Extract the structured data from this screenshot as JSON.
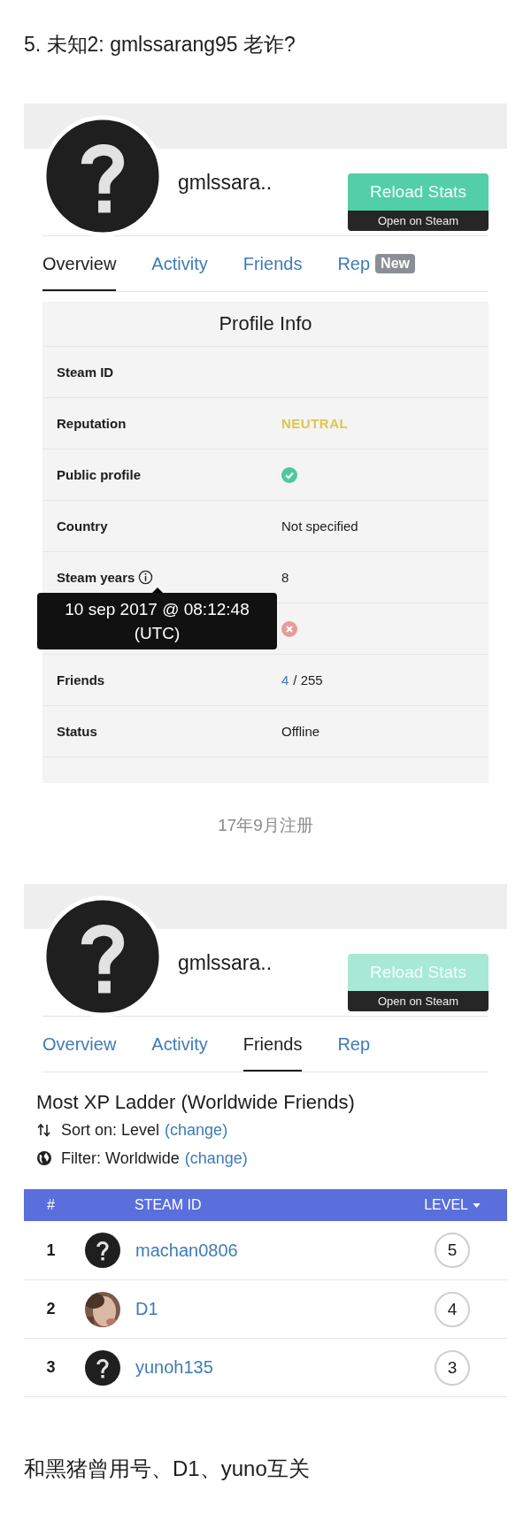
{
  "heading": "5. 未知2: gmlssarang95 老诈?",
  "sections": [
    {
      "kind": "profile",
      "name": "gmlssara..",
      "reload": {
        "label": "Reload Stats",
        "disabled": false
      },
      "open_label": "Open on Steam",
      "tabs": [
        {
          "label": "Overview",
          "selected": true
        },
        {
          "label": "Activity",
          "selected": false
        },
        {
          "label": "Friends",
          "selected": false
        },
        {
          "label": "Rep",
          "selected": false,
          "badge": "New"
        }
      ],
      "info": {
        "title": "Profile Info",
        "rows": [
          {
            "label": "Steam ID",
            "kind": "empty"
          },
          {
            "label": "Reputation",
            "kind": "reputation",
            "value": "NEUTRAL"
          },
          {
            "label": "Public profile",
            "kind": "flag",
            "on": true
          },
          {
            "label": "Country",
            "kind": "text",
            "value": "Not specified"
          },
          {
            "label": "Steam years",
            "kind": "text",
            "value": "8",
            "tooltip": "10 sep 2017 @ 08:12:48 (UTC)"
          },
          {
            "kind": "flag",
            "on": false
          },
          {
            "label": "Friends",
            "kind": "count",
            "count": "4",
            "total": "/ 255"
          },
          {
            "label": "Status",
            "kind": "text",
            "value": "Offline"
          }
        ]
      },
      "caption": "17年9月注册"
    },
    {
      "kind": "friends",
      "name": "gmlssara..",
      "reload": {
        "label": "Reload Stats",
        "disabled": true
      },
      "open_label": "Open on Steam",
      "tabs": [
        {
          "label": "Overview",
          "selected": false
        },
        {
          "label": "Activity",
          "selected": false
        },
        {
          "label": "Friends",
          "selected": true
        },
        {
          "label": "Rep",
          "selected": false
        }
      ],
      "ladder": {
        "title": "Most XP Ladder (Worldwide Friends)",
        "sort": {
          "text": "Sort on: Level",
          "link": "(change)"
        },
        "filter": {
          "text": "Filter: Worldwide",
          "link": "(change)"
        },
        "columns": [
          {
            "label": "#",
            "sorted": false
          },
          {
            "label": "STEAM ID",
            "sorted": false
          },
          {
            "label": "LEVEL",
            "sorted": true
          }
        ],
        "rows": [
          {
            "rank": "1",
            "kind": "unknown",
            "name": "machan0806",
            "level": "5"
          },
          {
            "rank": "2",
            "kind": "picture",
            "name": "D1",
            "level": "4"
          },
          {
            "rank": "3",
            "kind": "unknown",
            "name": "yunoh135",
            "level": "3"
          }
        ]
      }
    }
  ],
  "footer": "和黑猪曾用号、D1、yuno互关"
}
